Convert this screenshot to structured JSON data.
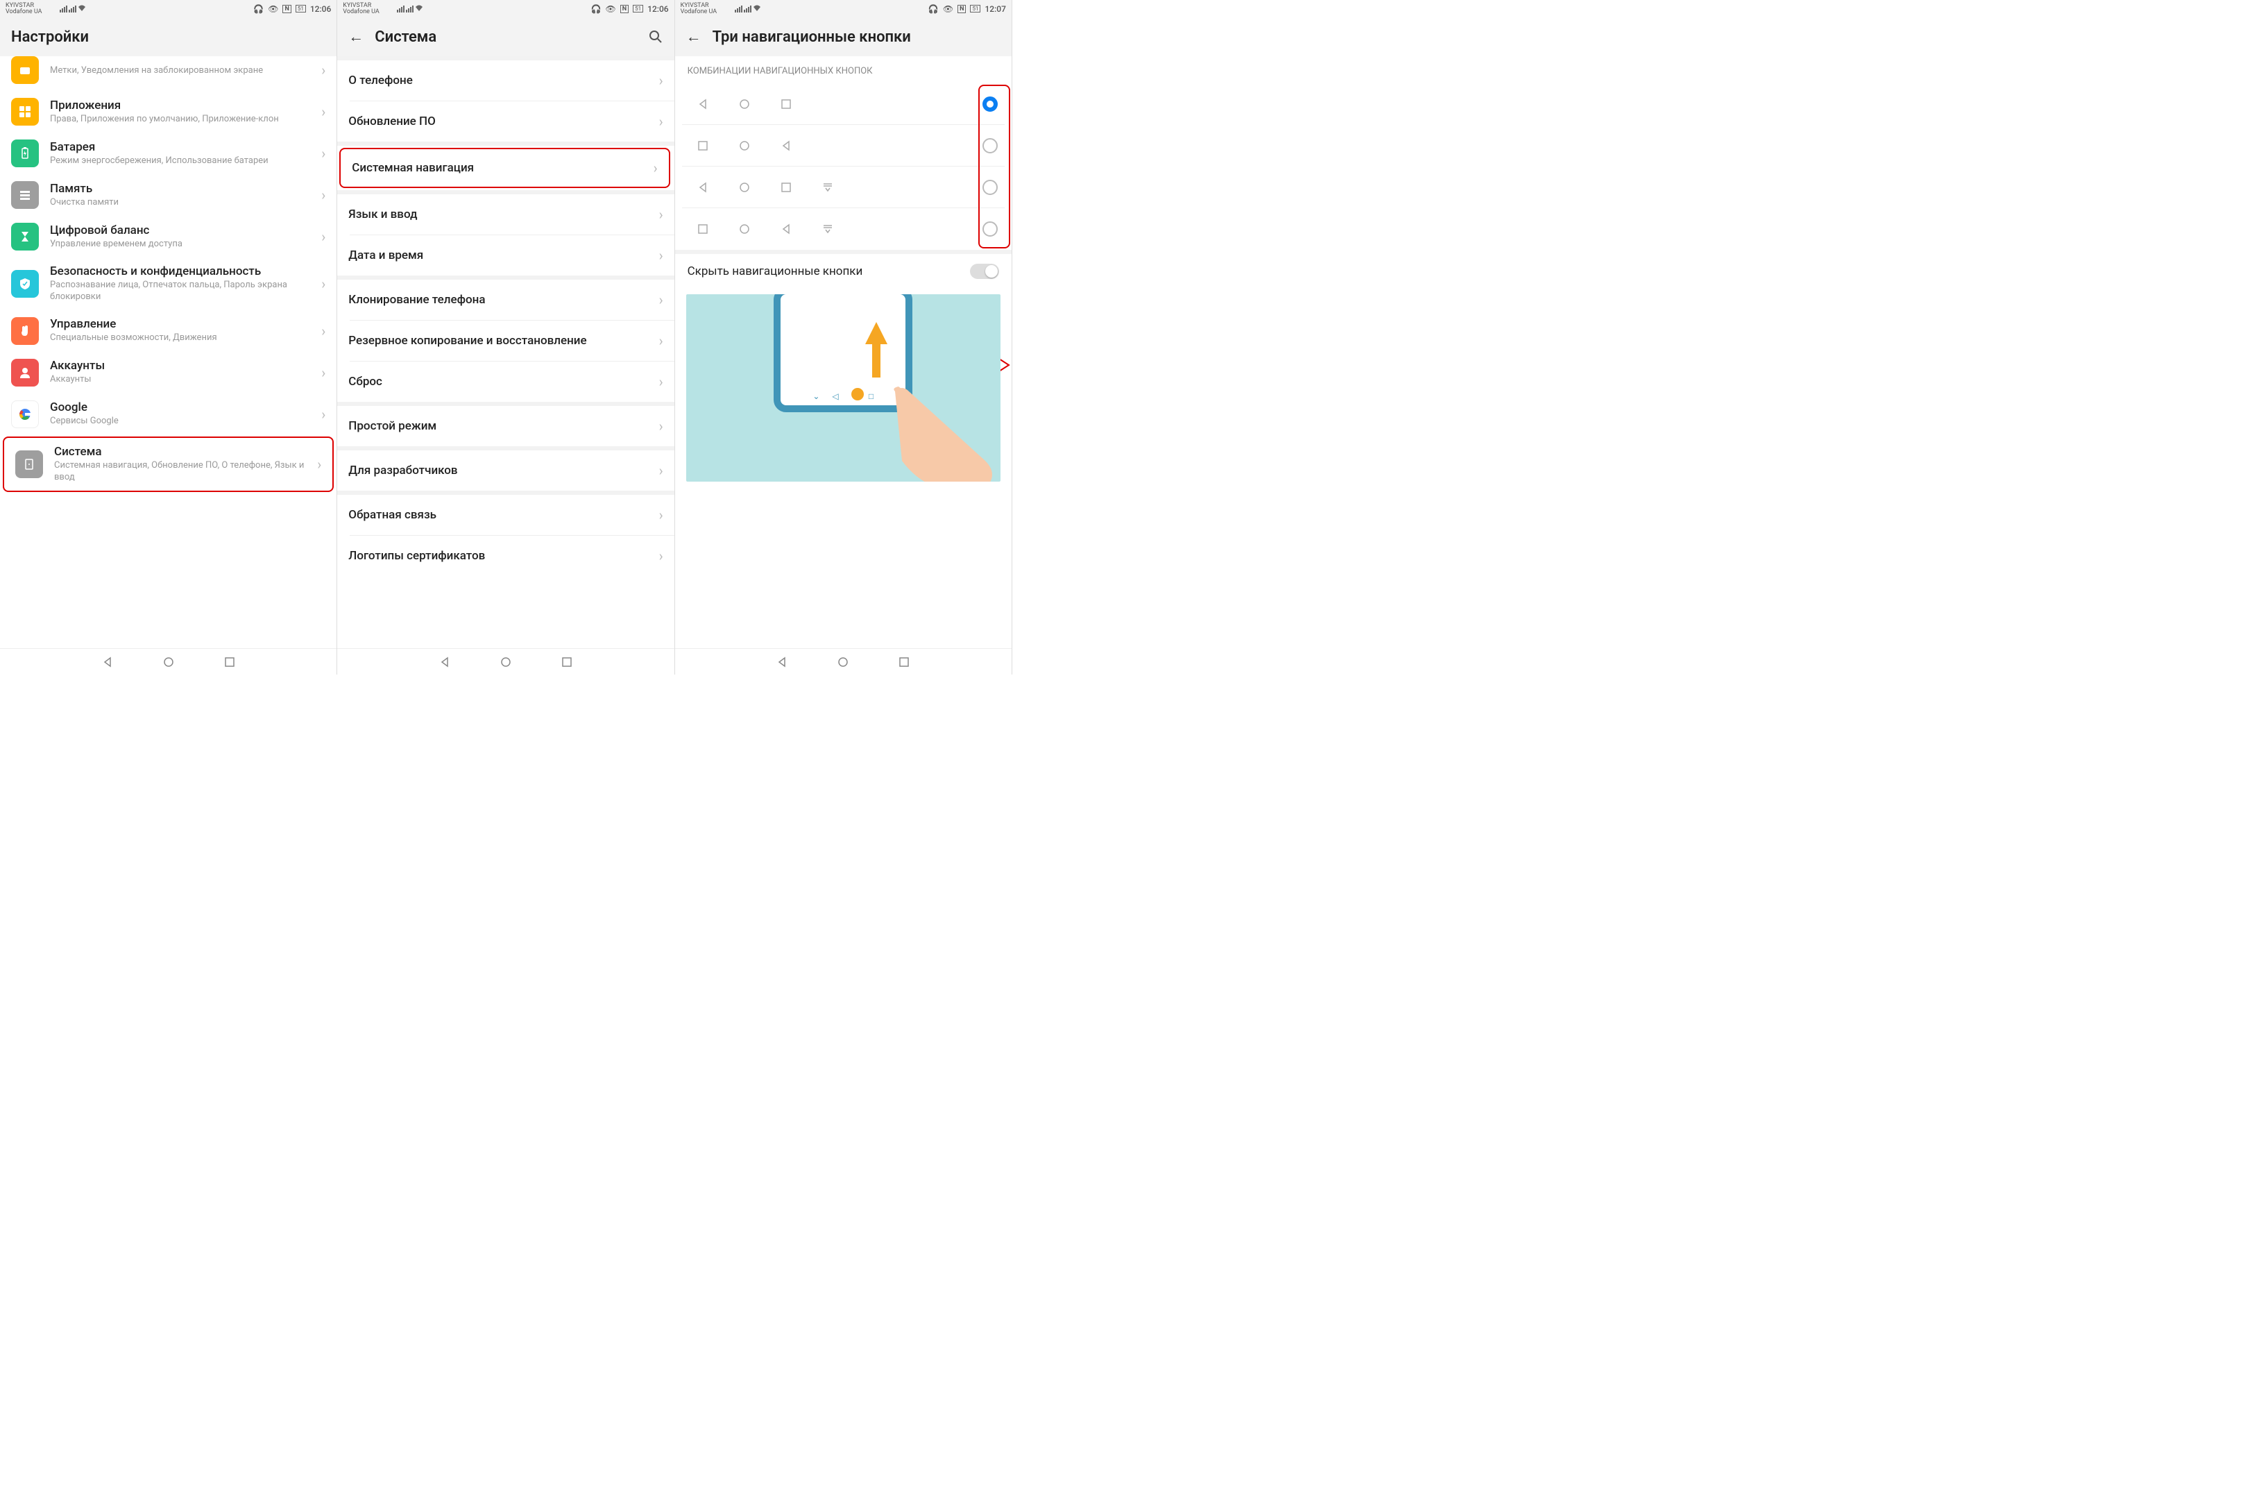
{
  "status": {
    "carrier1": "KYIVSTAR",
    "carrier2": "Vodafone UA",
    "battery": "51",
    "time_a": "12:06",
    "time_b": "12:07"
  },
  "screen1": {
    "title": "Настройки",
    "item0": {
      "label": "",
      "sub": "Метки, Уведомления на заблокированном экране"
    },
    "apps": {
      "label": "Приложения",
      "sub": "Права, Приложения по умолчанию, Приложение-клон"
    },
    "battery": {
      "label": "Батарея",
      "sub": "Режим энергосбережения, Использование батареи"
    },
    "storage": {
      "label": "Память",
      "sub": "Очистка памяти"
    },
    "digital": {
      "label": "Цифровой баланс",
      "sub": "Управление временем доступа"
    },
    "security": {
      "label": "Безопасность и конфиденциальность",
      "sub": "Распознавание лица, Отпечаток пальца, Пароль экрана блокировки"
    },
    "manage": {
      "label": "Управление",
      "sub": "Специальные возможности, Движения"
    },
    "accounts": {
      "label": "Аккаунты",
      "sub": "Аккаунты"
    },
    "google": {
      "label": "Google",
      "sub": "Сервисы Google"
    },
    "system": {
      "label": "Система",
      "sub": "Системная навигация, Обновление ПО, О телефоне, Язык и ввод"
    }
  },
  "screen2": {
    "title": "Система",
    "about": "О телефоне",
    "update": "Обновление ПО",
    "sysnav": "Системная навигация",
    "lang": "Язык и ввод",
    "date": "Дата и время",
    "clone": "Клонирование телефона",
    "backup": "Резервное копирование и восстановление",
    "reset": "Сброс",
    "simple": "Простой режим",
    "dev": "Для разработчиков",
    "feedback": "Обратная связь",
    "cert": "Логотипы сертификатов"
  },
  "screen3": {
    "title": "Три навигационные кнопки",
    "section": "КОМБИНАЦИИ НАВИГАЦИОННЫХ КНОПОК",
    "hide": "Скрыть навигационные кнопки"
  }
}
